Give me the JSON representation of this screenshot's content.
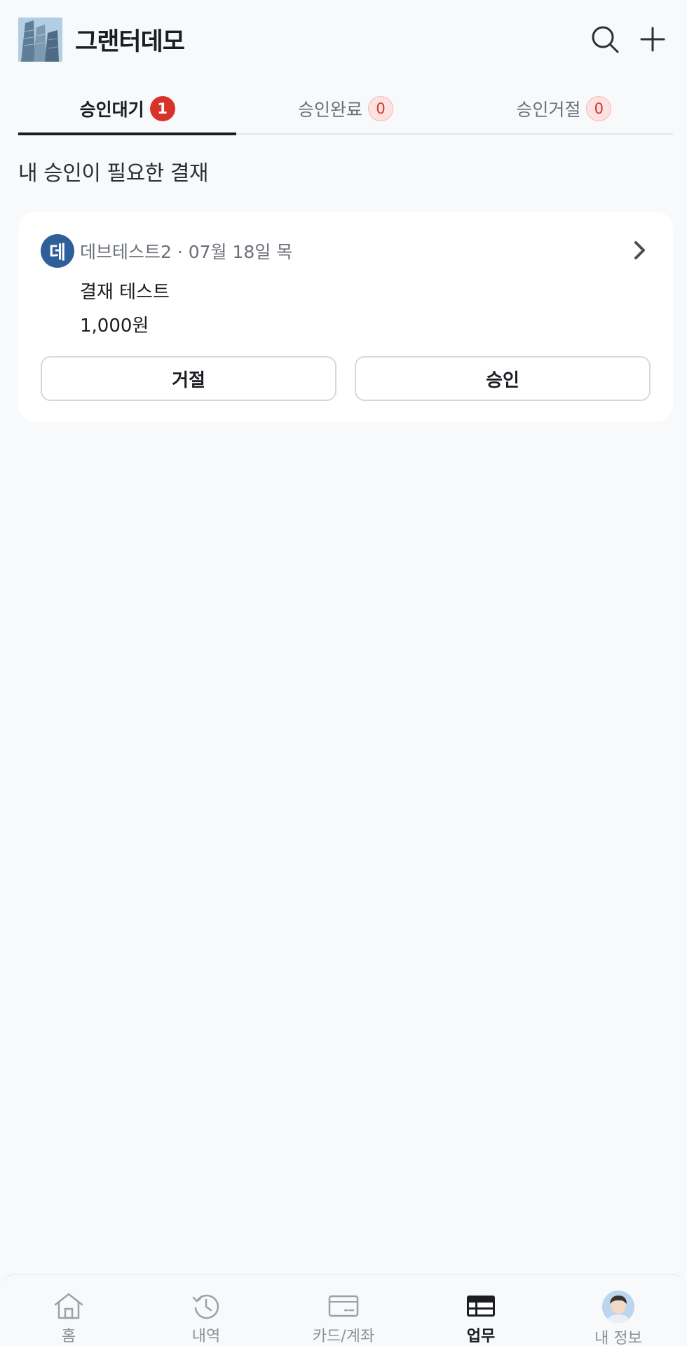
{
  "header": {
    "company_name": "그랜터데모",
    "search_icon": "search-icon",
    "add_icon": "plus-icon"
  },
  "tabs": [
    {
      "label": "승인대기",
      "count": "1",
      "active": true
    },
    {
      "label": "승인완료",
      "count": "0",
      "active": false
    },
    {
      "label": "승인거절",
      "count": "0",
      "active": false
    }
  ],
  "section": {
    "title": "내 승인이 필요한 결재"
  },
  "card": {
    "avatar_initial": "데",
    "meta": "데브테스트2 · 07월 18일 목",
    "title": "결재 테스트",
    "amount": "1,000원",
    "reject_label": "거절",
    "approve_label": "승인"
  },
  "bottom_nav": [
    {
      "label": "홈",
      "icon": "home-icon",
      "active": false
    },
    {
      "label": "내역",
      "icon": "history-icon",
      "active": false
    },
    {
      "label": "카드/계좌",
      "icon": "card-icon",
      "active": false
    },
    {
      "label": "업무",
      "icon": "work-icon",
      "active": true
    },
    {
      "label": "내 정보",
      "icon": "profile-icon",
      "active": false
    }
  ],
  "colors": {
    "background": "#f8f9fb",
    "badge_red": "#d9322a",
    "avatar_blue": "#2f5f9a",
    "text_primary": "#1b1d22",
    "text_secondary": "#6a6f78"
  }
}
